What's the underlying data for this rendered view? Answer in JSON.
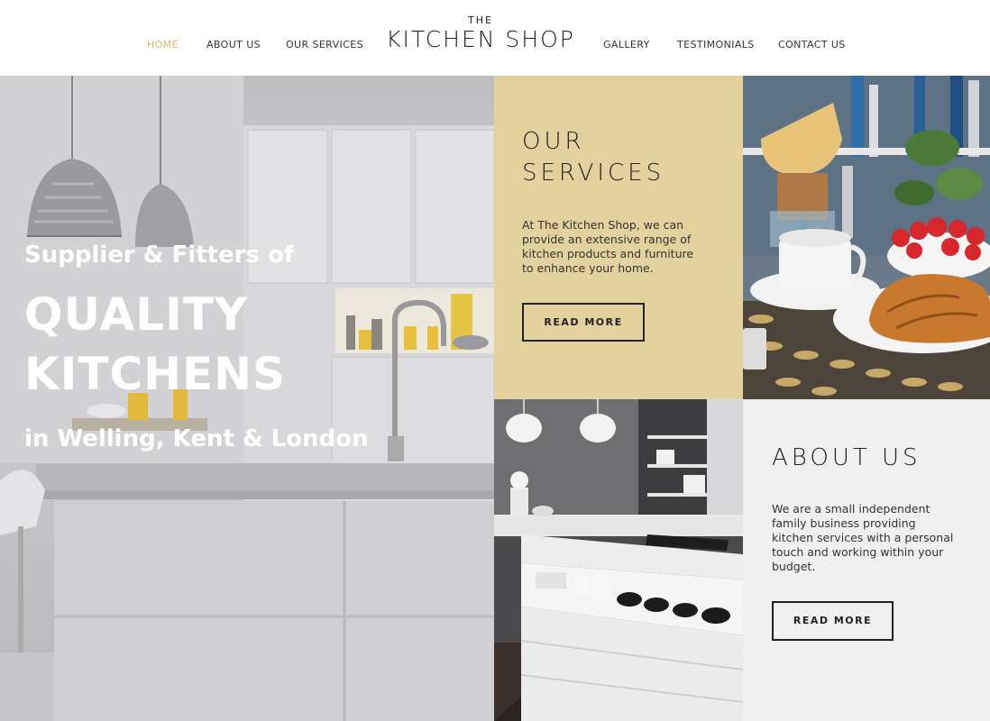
{
  "nav": {
    "items": [
      {
        "label": "HOME",
        "active": true
      },
      {
        "label": "ABOUT US"
      },
      {
        "label": "OUR SERVICES"
      },
      {
        "label": "GALLERY"
      },
      {
        "label": "TESTIMONIALS"
      },
      {
        "label": "CONTACT US"
      }
    ],
    "active_color": "#d9b861"
  },
  "logo": {
    "small": "THE",
    "main": "KITCHEN SHOP"
  },
  "hero": {
    "line1": "Supplier & Fitters of",
    "line2": "QUALITY",
    "line3": "KITCHENS",
    "line4": "in Welling, Kent & London"
  },
  "services": {
    "title_line1": "OUR",
    "title_line2": "SERVICES",
    "text_lines": [
      "At The Kitchen Shop, we can",
      "provide an extensive range of",
      "kitchen products and furniture",
      "to enhance your home."
    ],
    "button": "READ MORE",
    "bg_color": "#e3d29e"
  },
  "about": {
    "title": "ABOUT US",
    "text_lines": [
      "We are a small independent",
      "family business providing",
      "kitchen services with a personal",
      "touch and working within your",
      "budget."
    ],
    "button": "READ MORE",
    "bg_color": "#f0f0f0"
  }
}
